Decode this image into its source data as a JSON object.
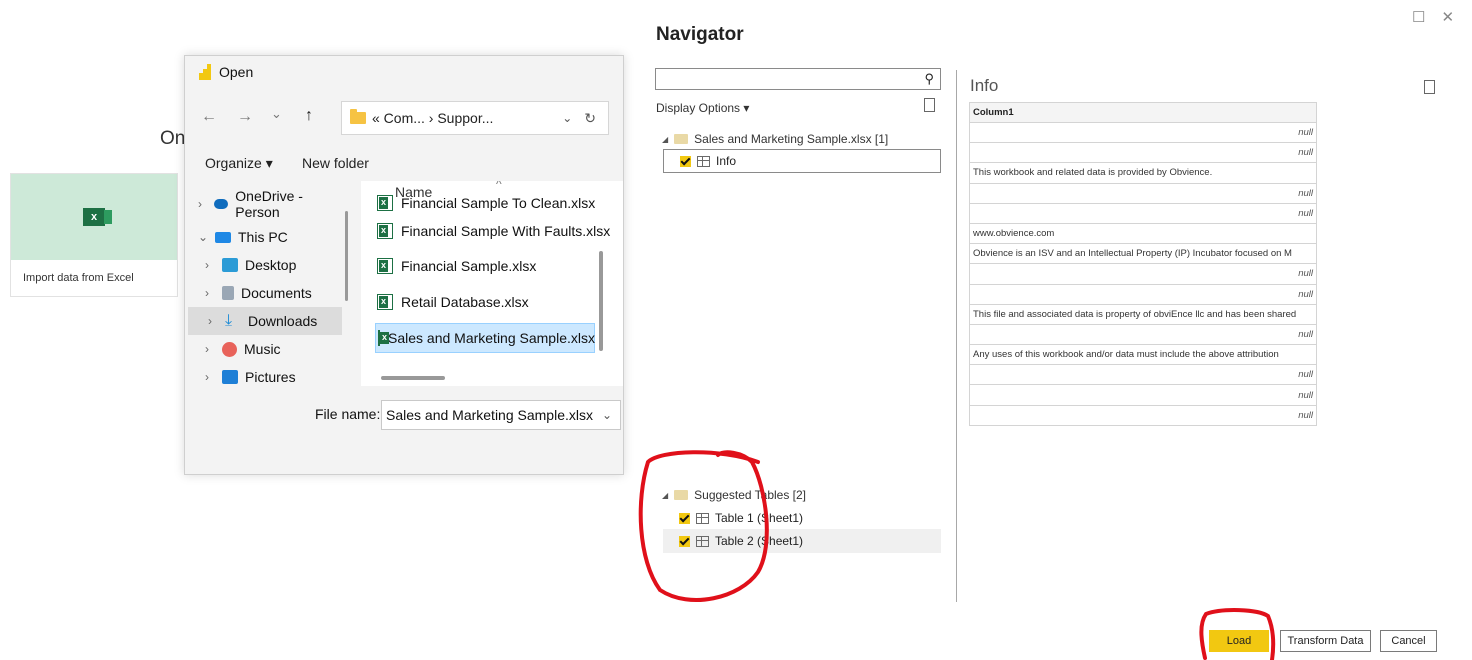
{
  "background": {
    "partial_heading": "On",
    "excel_card": {
      "icon_letter": "x",
      "label": "Import data from Excel"
    }
  },
  "open_dialog": {
    "title": "Open",
    "nav": {
      "back": "←",
      "forward": "→",
      "dropdown": "⌄",
      "up": "↑",
      "refresh": "↻"
    },
    "address_path": "« Com... › Suppor...",
    "toolbar": {
      "organize": "Organize ▾",
      "new_folder": "New folder"
    },
    "tree": [
      {
        "label": "OneDrive - Person",
        "chev": "›",
        "icon": "cloud-icon",
        "color": "#0f6cbd"
      },
      {
        "label": "This PC",
        "chev": "⌄",
        "icon": "computer-icon",
        "color": "#1e88e5"
      },
      {
        "label": "Desktop",
        "chev": "›",
        "icon": "desktop-icon",
        "color": "#2b9bd6"
      },
      {
        "label": "Documents",
        "chev": "›",
        "icon": "documents-icon",
        "color": "#9aa7b5"
      },
      {
        "label": "Downloads",
        "chev": "›",
        "icon": "downloads-icon",
        "color": "#1a8ad6"
      },
      {
        "label": "Music",
        "chev": "›",
        "icon": "music-icon",
        "color": "#e8625a"
      },
      {
        "label": "Pictures",
        "chev": "›",
        "icon": "pictures-icon",
        "color": "#1e7fd6"
      }
    ],
    "column_header": "Name",
    "files": [
      "Financial Sample To Clean.xlsx",
      "Financial Sample With Faults.xlsx",
      "Financial Sample.xlsx",
      "Retail Database.xlsx",
      "Sales and Marketing Sample.xlsx"
    ],
    "file_name_label": "File name:",
    "file_name_value": "Sales and Marketing Sample.xlsx"
  },
  "navigator": {
    "title": "Navigator",
    "window_controls": {
      "maximize": "☐",
      "close": "✕"
    },
    "display_options": "Display Options ▾",
    "workbook_group": "Sales and Marketing Sample.xlsx [1]",
    "workbook_items": [
      "Info"
    ],
    "suggested_group": "Suggested Tables [2]",
    "suggested_items": [
      "Table 1 (Sheet1)",
      "Table 2 (Sheet1)"
    ],
    "preview": {
      "title": "Info",
      "column": "Column1",
      "rows": [
        "null",
        "null",
        "This workbook and related data is provided by Obvience.",
        "null",
        "null",
        "www.obvience.com",
        "Obvience is an ISV and an Intellectual Property (IP) Incubator focused on M",
        "null",
        "null",
        "This file and associated data is property of obviEnce llc and has been shared",
        "null",
        "Any uses of this workbook and/or data must include the above attribution",
        "null",
        "null",
        "null"
      ]
    },
    "buttons": {
      "load": "Load",
      "transform": "Transform Data",
      "cancel": "Cancel"
    }
  },
  "colors": {
    "accent_yellow": "#f2c811",
    "annotation_red": "#e0101a",
    "excel_green": "#1d7044"
  }
}
